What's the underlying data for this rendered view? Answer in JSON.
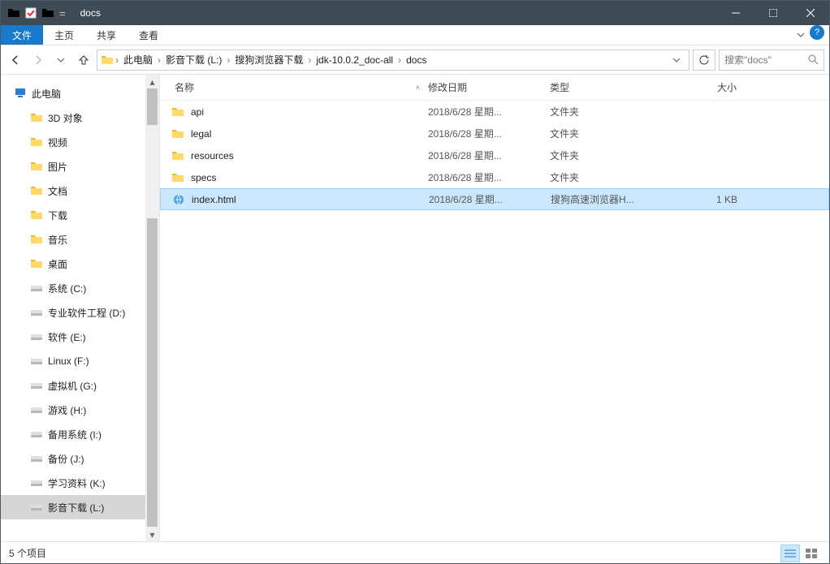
{
  "window": {
    "title": "docs"
  },
  "ribbon": {
    "file": "文件",
    "tabs": [
      "主页",
      "共享",
      "查看"
    ]
  },
  "breadcrumbs": [
    "此电脑",
    "影音下载 (L:)",
    "搜狗浏览器下载",
    "jdk-10.0.2_doc-all",
    "docs"
  ],
  "search": {
    "placeholder": "搜索\"docs\""
  },
  "sidebar": {
    "root": "此电脑",
    "items": [
      {
        "label": "3D 对象",
        "icon": "3d"
      },
      {
        "label": "视频",
        "icon": "video"
      },
      {
        "label": "图片",
        "icon": "pic"
      },
      {
        "label": "文档",
        "icon": "doc"
      },
      {
        "label": "下载",
        "icon": "dl"
      },
      {
        "label": "音乐",
        "icon": "music"
      },
      {
        "label": "桌面",
        "icon": "desk"
      },
      {
        "label": "系统 (C:)",
        "icon": "sysdrive"
      },
      {
        "label": "专业软件工程 (D:)",
        "icon": "drive"
      },
      {
        "label": "软件 (E:)",
        "icon": "drive"
      },
      {
        "label": "Linux (F:)",
        "icon": "drive"
      },
      {
        "label": "虚拟机 (G:)",
        "icon": "drive"
      },
      {
        "label": "游戏 (H:)",
        "icon": "drive"
      },
      {
        "label": "备用系统 (I:)",
        "icon": "drive"
      },
      {
        "label": "备份 (J:)",
        "icon": "drive"
      },
      {
        "label": "学习资料 (K:)",
        "icon": "drive"
      },
      {
        "label": "影音下载 (L:)",
        "icon": "drive",
        "selected": true
      }
    ]
  },
  "columns": {
    "name": "名称",
    "date": "修改日期",
    "type": "类型",
    "size": "大小"
  },
  "files": [
    {
      "name": "api",
      "date": "2018/6/28 星期...",
      "type": "文件夹",
      "size": "",
      "icon": "folder"
    },
    {
      "name": "legal",
      "date": "2018/6/28 星期...",
      "type": "文件夹",
      "size": "",
      "icon": "folder"
    },
    {
      "name": "resources",
      "date": "2018/6/28 星期...",
      "type": "文件夹",
      "size": "",
      "icon": "folder"
    },
    {
      "name": "specs",
      "date": "2018/6/28 星期...",
      "type": "文件夹",
      "size": "",
      "icon": "folder"
    },
    {
      "name": "index.html",
      "date": "2018/6/28 星期...",
      "type": "搜狗高速浏览器H...",
      "size": "1 KB",
      "icon": "html",
      "selected": true
    }
  ],
  "status": {
    "text": "5 个项目"
  }
}
